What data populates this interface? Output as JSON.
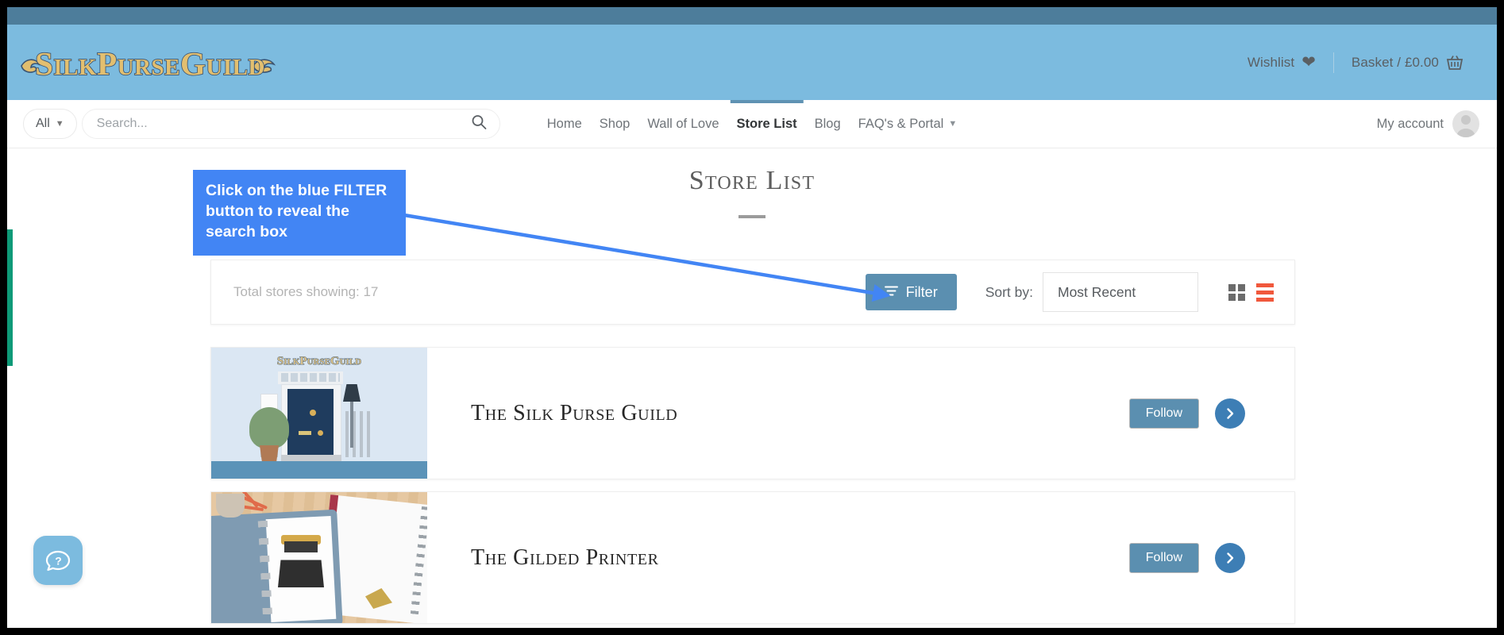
{
  "site": {
    "logo_text": "SilkPurseGuild",
    "brand_blue": "#7cbbdf",
    "accent_blue": "#5b8fb0",
    "annotation_blue": "#4285f4",
    "list_active_color": "#f0583c"
  },
  "masthead": {
    "wishlist_label": "Wishlist",
    "wishlist_icon": "heart-icon",
    "basket_label": "Basket / £0.00",
    "basket_icon": "basket-icon"
  },
  "search": {
    "scope_label": "All",
    "scope_caret": "chevron-down-icon",
    "placeholder": "Search...",
    "value": "",
    "icon": "search-icon"
  },
  "nav": {
    "items": [
      {
        "label": "Home",
        "active": false
      },
      {
        "label": "Shop",
        "active": false
      },
      {
        "label": "Wall of Love",
        "active": false
      },
      {
        "label": "Store List",
        "active": true
      },
      {
        "label": "Blog",
        "active": false
      },
      {
        "label": "FAQ's & Portal",
        "active": false,
        "caret": "chevron-down-icon"
      }
    ]
  },
  "account": {
    "label": "My account",
    "avatar_icon": "avatar-icon"
  },
  "page": {
    "title": "Store List"
  },
  "toolbar": {
    "total_label": "Total stores showing: 17",
    "filter_label": "Filter",
    "filter_icon": "funnel-icon",
    "sort_label": "Sort by:",
    "sort_value": "Most Recent",
    "sort_options": [
      "Most Recent"
    ],
    "grid_view_icon": "grid-view-icon",
    "list_view_icon": "list-view-icon"
  },
  "stores": [
    {
      "name": "The Silk Purse Guild",
      "thumb_alt": "illustration-blue-front-door",
      "follow_label": "Follow",
      "go_icon": "chevron-right-icon"
    },
    {
      "name": "The Gilded Printer",
      "thumb_alt": "photo-binder-typewriter-print",
      "follow_label": "Follow",
      "go_icon": "chevron-right-icon"
    }
  ],
  "annotation": {
    "text": "Click on the blue FILTER button to reveal the search box"
  },
  "widgets": {
    "help_icon": "question-chat-icon",
    "side_tab_label": ""
  }
}
